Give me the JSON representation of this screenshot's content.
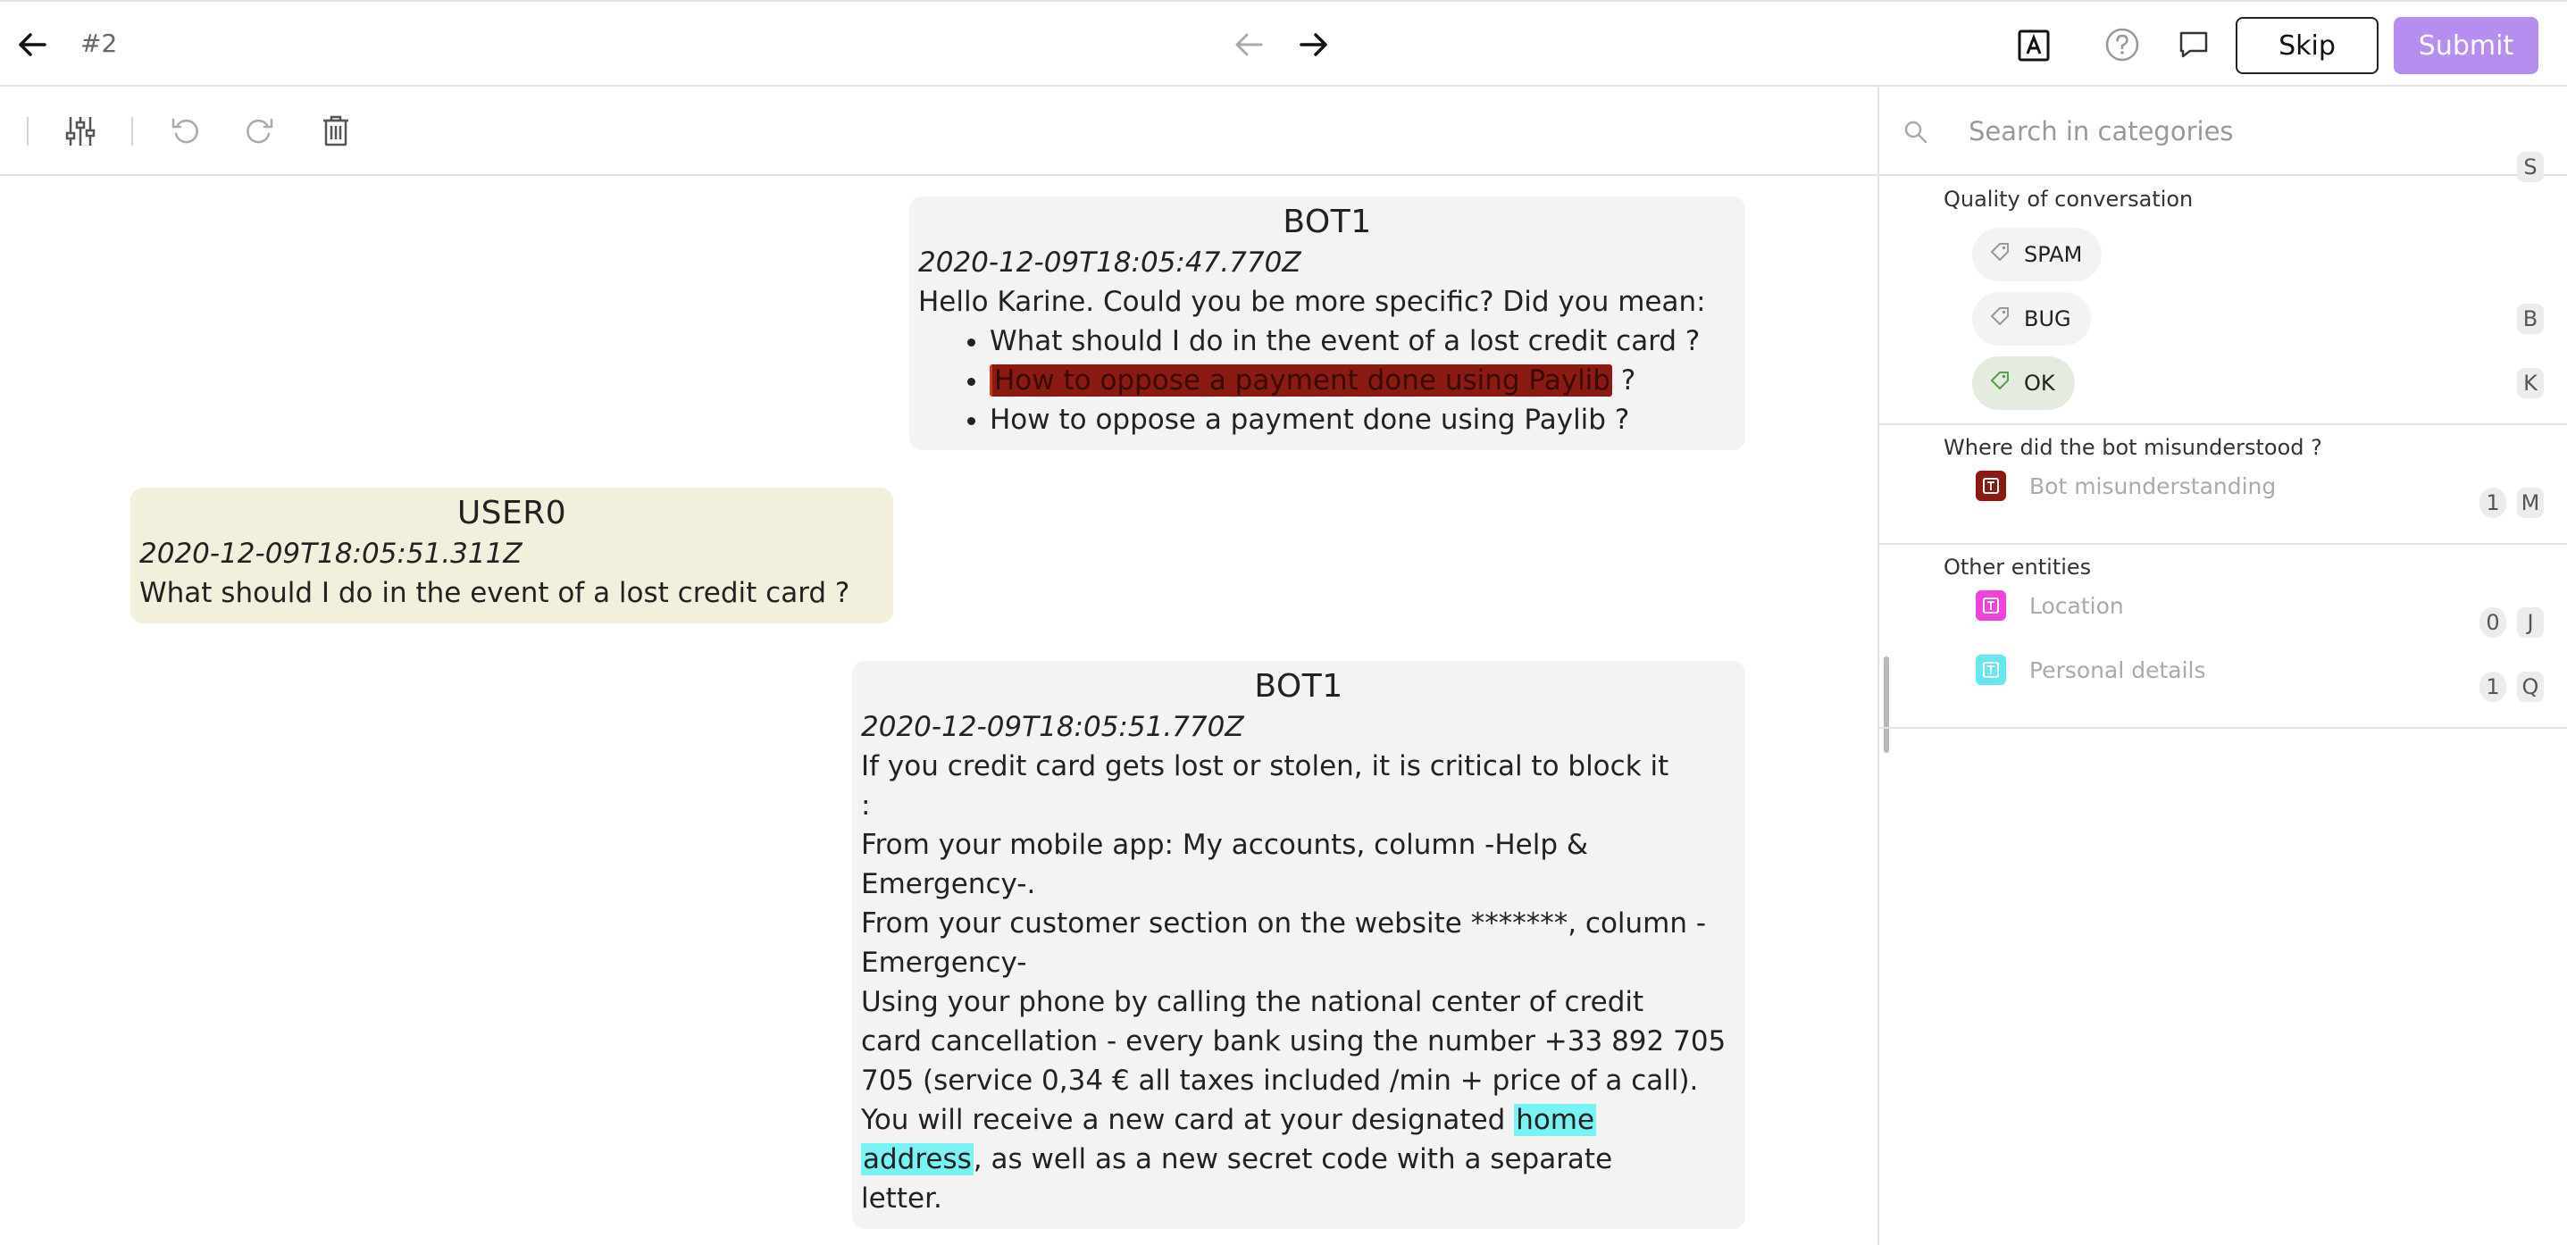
{
  "header": {
    "task_id": "#2",
    "skip_label": "Skip",
    "submit_label": "Submit"
  },
  "search": {
    "placeholder": "Search in categories"
  },
  "messages": [
    {
      "speaker": "BOT1",
      "timestamp": "2020-12-09T18:05:47.770Z",
      "text": "Hello Karine. Could you be more specific? Did you mean:",
      "bullets": [
        "What should I do in the event of a lost credit card ?",
        "How to oppose a payment done using Paylib",
        " ?",
        "How to oppose a payment done using Paylib ?"
      ]
    },
    {
      "speaker": "USER0",
      "timestamp": "2020-12-09T18:05:51.311Z",
      "text": "What should I do in the event of a lost credit card ?"
    },
    {
      "speaker": "BOT1",
      "timestamp": "2020-12-09T18:05:51.770Z",
      "lines": [
        "If you credit card gets lost or stolen, it is critical to block it",
        ":",
        "From your mobile app: My accounts, column -Help &",
        "Emergency-.",
        "From your customer section on the website *******, column -",
        "Emergency-",
        "Using your phone by calling the national center of credit",
        "card cancellation - every bank using the number +33 892 705",
        "705 (service 0,34 € all taxes included /min + price of a call).",
        "You will receive a new card at your designated "
      ],
      "hl1": "home",
      "hl2": "address",
      "tail1": ", as well as a new secret code with a separate",
      "tail2": "letter."
    }
  ],
  "categories": {
    "quality": {
      "title": "Quality of conversation",
      "items": [
        {
          "label": "SPAM",
          "key": "S"
        },
        {
          "label": "BUG",
          "key": "B"
        },
        {
          "label": "OK",
          "key": "K"
        }
      ]
    },
    "misunderstood": {
      "title": "Where did the bot misunderstood ?",
      "items": [
        {
          "label": "Bot misunderstanding",
          "count": "1",
          "key": "M",
          "color": "#8b1a12"
        }
      ]
    },
    "entities": {
      "title": "Other entities",
      "items": [
        {
          "label": "Location",
          "count": "0",
          "key": "J",
          "color": "#ee44d9"
        },
        {
          "label": "Personal details",
          "count": "1",
          "key": "Q",
          "color": "#66e6ee"
        }
      ]
    }
  }
}
